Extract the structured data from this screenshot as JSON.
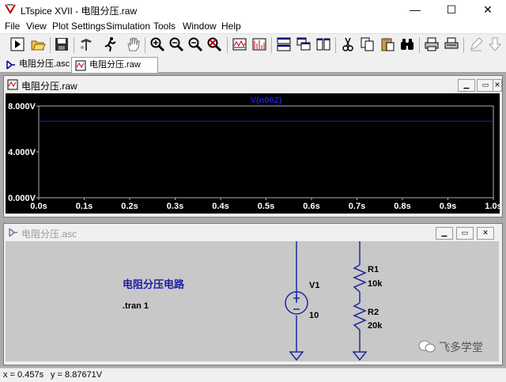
{
  "window": {
    "title": "LTspice XVII - 电阻分压.raw",
    "minimize": "—",
    "maximize": "☐",
    "close": "✕"
  },
  "menu": [
    "File",
    "View",
    "Plot Settings",
    "Simulation",
    "Tools",
    "Window",
    "Help"
  ],
  "toolbar_icons": [
    "new-schematic-icon",
    "open-icon",
    "save-icon",
    "control-panel-icon",
    "run-icon",
    "halt-icon",
    "zoom-in-icon",
    "zoom-out-icon",
    "zoom-full-icon",
    "zoom-cancel-icon",
    "autorange-icon",
    "fft-icon",
    "tile-horizontal-icon",
    "cascade-icon",
    "tile-vertical-icon",
    "cut-icon",
    "copy-icon",
    "paste-icon",
    "find-icon",
    "print-icon",
    "print-preview-icon",
    "pencil-icon",
    "arrow-down-icon"
  ],
  "tabs": [
    {
      "label": "电阻分压.asc",
      "icon": "schematic-icon"
    },
    {
      "label": "电阻分压.raw",
      "icon": "waveform-icon"
    }
  ],
  "waveform_window": {
    "title": "电阻分压.raw",
    "trace_label": "V(n002)",
    "trace_color": "#1e1ec8"
  },
  "chart_data": {
    "type": "line",
    "series": [
      {
        "name": "V(n002)",
        "x": [
          0.0,
          1.0
        ],
        "y": [
          6.67,
          6.67
        ],
        "color": "#1e1ec8"
      }
    ],
    "xlim": [
      0.0,
      1.0
    ],
    "ylim": [
      0.0,
      8.0
    ],
    "x_ticks": [
      "0.0s",
      "0.1s",
      "0.2s",
      "0.3s",
      "0.4s",
      "0.5s",
      "0.6s",
      "0.7s",
      "0.8s",
      "0.9s",
      "1.0s"
    ],
    "y_ticks": [
      "8.000V",
      "4.000V",
      "0.000V"
    ],
    "grid": true,
    "background": "#000000"
  },
  "schematic_window": {
    "title": "电阻分压.asc",
    "circuit_title": "电阻分压电路",
    "directive": ".tran 1",
    "v1_name": "V1",
    "v1_value": "10",
    "r1_name": "R1",
    "r1_value": "10k",
    "r2_name": "R2",
    "r2_value": "20k",
    "wire_color": "#1c2a9c",
    "text_color": "#1c1ca8"
  },
  "watermark": "飞多学堂",
  "status": {
    "x": "x = 0.457s",
    "y": "y = 8.87671V"
  }
}
